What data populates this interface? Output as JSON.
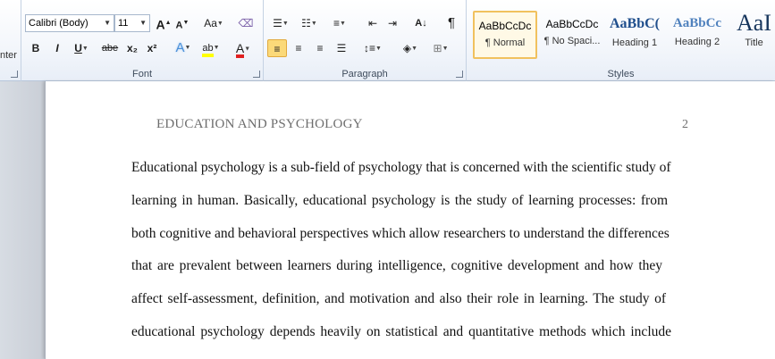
{
  "ribbon": {
    "clipboard": {
      "partial_label": "nter"
    },
    "font": {
      "label": "Font",
      "font_name": "Calibri (Body)",
      "font_size": "11",
      "grow_font": "A",
      "shrink_font": "A",
      "change_case": "Aa",
      "bold": "B",
      "italic": "I",
      "underline": "U",
      "strikethrough": "abe",
      "subscript": "x₂",
      "superscript": "x²",
      "text_effects": "A",
      "highlight": "ab",
      "font_color": "A"
    },
    "paragraph": {
      "label": "Paragraph",
      "show_marks": "¶"
    },
    "styles": {
      "label": "Styles",
      "items": [
        {
          "sample": "AaBbCcDc",
          "name": "¶ Normal"
        },
        {
          "sample": "AaBbCcDc",
          "name": "¶ No Spaci..."
        },
        {
          "sample": "AaBbC(",
          "name": "Heading 1"
        },
        {
          "sample": "AaBbCc",
          "name": "Heading 2"
        },
        {
          "sample": "AaI",
          "name": "Title"
        }
      ]
    }
  },
  "document": {
    "header": "EDUCATION AND PSYCHOLOGY",
    "page_number": "2",
    "lines": [
      "Educational psychology is a sub-field of psychology that is concerned with the scientific study of",
      "learning in human. Basically, educational psychology is the study of learning processes: from",
      "both cognitive and behavioral perspectives which allow researchers to understand the differences",
      "that are prevalent between learners during intelligence, cognitive development and how they",
      "affect self-assessment, definition, and motivation and also their role in learning. The study of",
      "educational psychology depends heavily on statistical and quantitative methods which include"
    ]
  },
  "colors": {
    "highlight": "#ffff00",
    "font_color": "#e02020",
    "heading": "#1f4e8c"
  }
}
